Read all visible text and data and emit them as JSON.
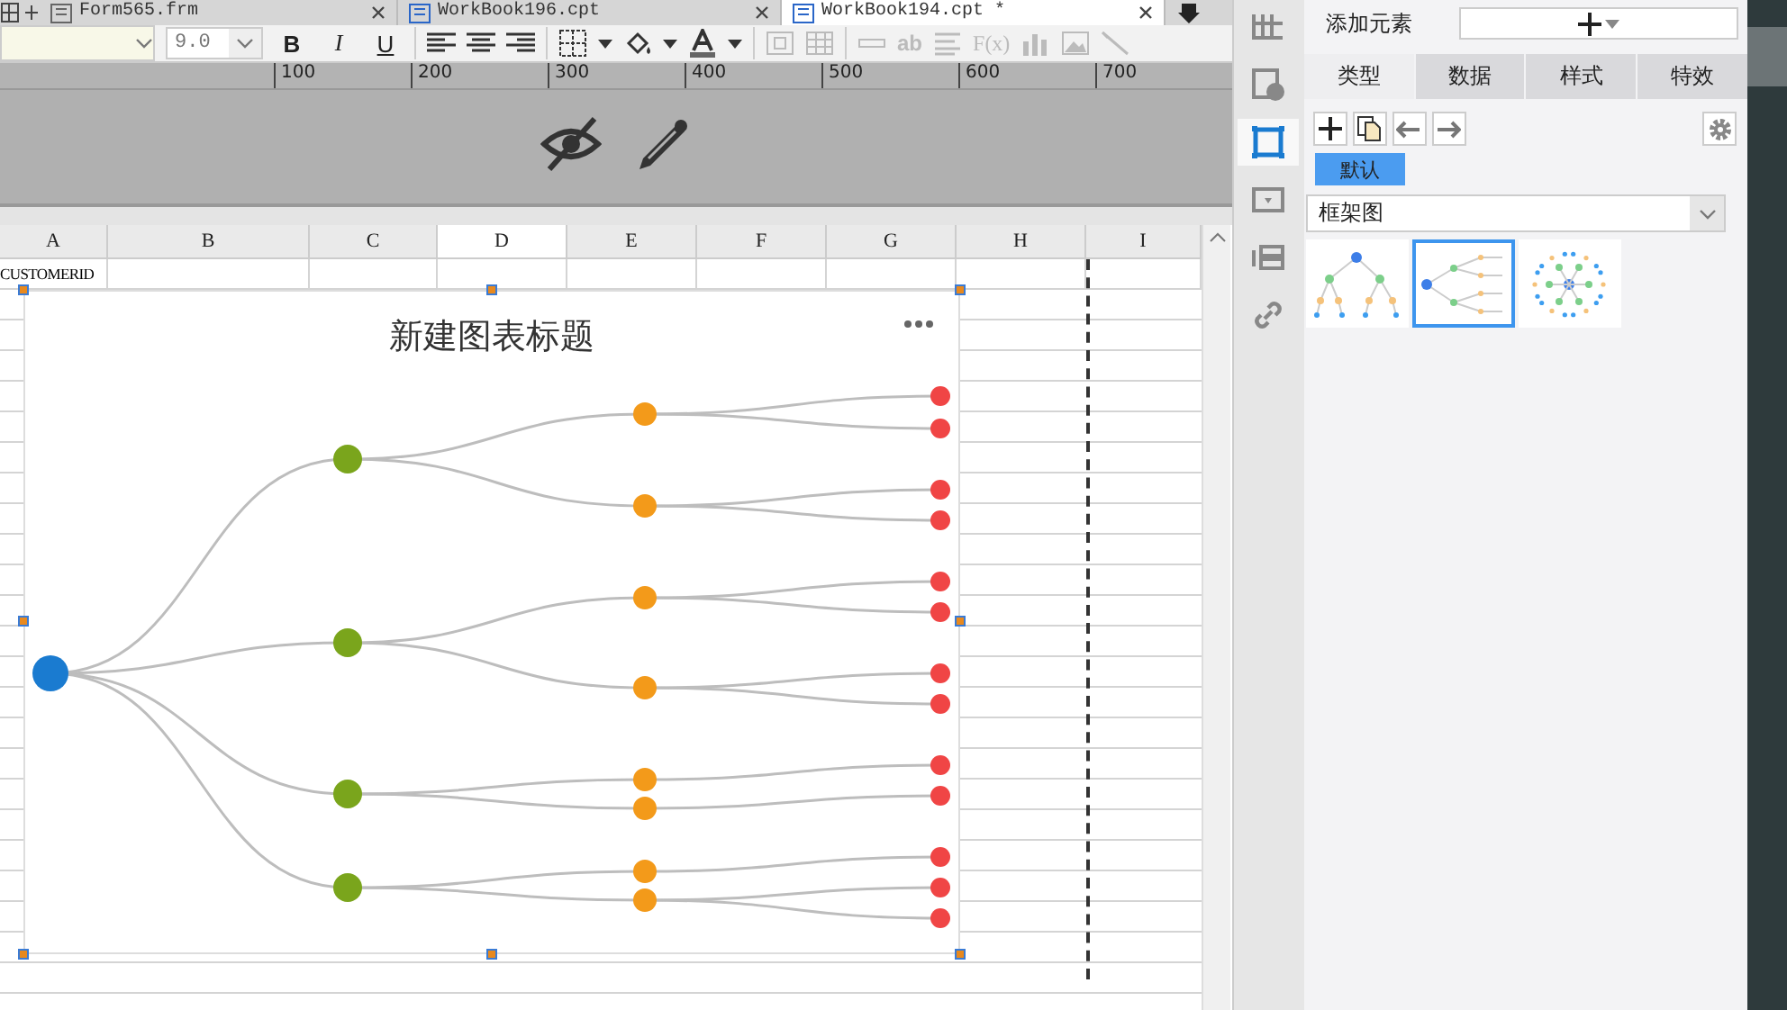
{
  "file_tabs": [
    {
      "label": "Form565.frm",
      "selected": false
    },
    {
      "label": "WorkBook196.cpt",
      "selected": false
    },
    {
      "label": "WorkBook194.cpt *",
      "selected": true
    }
  ],
  "toolbar": {
    "font_size": "9.0",
    "format_buttons": [
      "B",
      "I",
      "U"
    ],
    "disabled_tools": [
      "ab",
      "F(x)"
    ]
  },
  "ruler": [
    "100",
    "200",
    "300",
    "400",
    "500",
    "600",
    "700"
  ],
  "sheet": {
    "columns": [
      "A",
      "B",
      "C",
      "D",
      "E",
      "F",
      "G",
      "H",
      "I"
    ],
    "row_1": [
      "CUSTOMERID"
    ]
  },
  "chart": {
    "title": "新建图表标题"
  },
  "side_icons": [
    {
      "selected": false
    },
    {
      "selected": false
    },
    {
      "selected": true
    },
    {
      "selected": false
    },
    {
      "selected": false
    },
    {
      "selected": false
    }
  ],
  "panel": {
    "add_label": "添加元素",
    "tabs": [
      {
        "label": "类型",
        "selected": true
      },
      {
        "label": "数据",
        "selected": false
      },
      {
        "label": "样式",
        "selected": false
      },
      {
        "label": "特效",
        "selected": false
      }
    ],
    "style_chip": {
      "label": "默认",
      "selected": true
    },
    "chart_type": "框架图",
    "thumbnails": [
      {
        "selected": false
      },
      {
        "selected": true
      },
      {
        "selected": false
      }
    ]
  }
}
